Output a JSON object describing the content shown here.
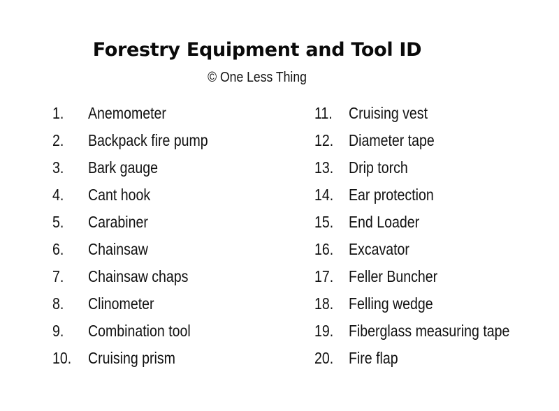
{
  "header": {
    "title": "Forestry Equipment and Tool ID",
    "subtitle": "© One Less Thing"
  },
  "list": {
    "left_column": [
      {
        "number": "1.",
        "label": "Anemometer"
      },
      {
        "number": "2.",
        "label": "Backpack fire pump"
      },
      {
        "number": "3.",
        "label": "Bark gauge"
      },
      {
        "number": "4.",
        "label": "Cant hook"
      },
      {
        "number": "5.",
        "label": "Carabiner"
      },
      {
        "number": "6.",
        "label": "Chainsaw"
      },
      {
        "number": "7.",
        "label": "Chainsaw chaps"
      },
      {
        "number": "8.",
        "label": "Clinometer"
      },
      {
        "number": "9.",
        "label": "Combination tool"
      },
      {
        "number": "10.",
        "label": "Cruising prism"
      }
    ],
    "right_column": [
      {
        "number": "11.",
        "label": "Cruising vest"
      },
      {
        "number": "12.",
        "label": "Diameter tape"
      },
      {
        "number": "13.",
        "label": "Drip torch"
      },
      {
        "number": "14.",
        "label": "Ear protection"
      },
      {
        "number": "15.",
        "label": "End Loader"
      },
      {
        "number": "16.",
        "label": "Excavator"
      },
      {
        "number": "17.",
        "label": "Feller Buncher"
      },
      {
        "number": "18.",
        "label": "Felling wedge"
      },
      {
        "number": "19.",
        "label": "Fiberglass measuring tape"
      },
      {
        "number": "20.",
        "label": "Fire flap"
      }
    ]
  }
}
